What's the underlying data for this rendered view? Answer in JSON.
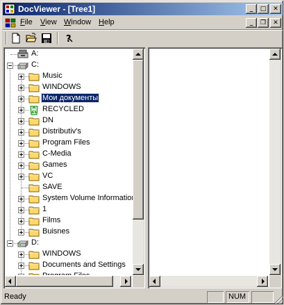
{
  "window": {
    "title": "DocViewer - [Tree1]"
  },
  "menu": {
    "items": [
      {
        "label": "File",
        "accel": "F",
        "rest": "ile"
      },
      {
        "label": "View",
        "accel": "V",
        "rest": "iew"
      },
      {
        "label": "Window",
        "accel": "W",
        "rest": "indow"
      },
      {
        "label": "Help",
        "accel": "H",
        "rest": "elp"
      }
    ]
  },
  "toolbar": {
    "buttons": [
      {
        "name": "new",
        "icon": "new-document-icon"
      },
      {
        "name": "open",
        "icon": "open-folder-icon"
      },
      {
        "name": "save",
        "icon": "floppy-disk-icon"
      },
      {
        "name": "help",
        "icon": "help-question-icon"
      }
    ]
  },
  "tree": {
    "items": [
      {
        "label": "A:",
        "icon": "floppy-drive-icon",
        "level": 0,
        "expander": "none"
      },
      {
        "label": "C:",
        "icon": "hard-drive-icon",
        "level": 0,
        "expander": "minus"
      },
      {
        "label": "Music",
        "icon": "folder-icon",
        "level": 1,
        "expander": "plus"
      },
      {
        "label": "WINDOWS",
        "icon": "folder-icon",
        "level": 1,
        "expander": "plus"
      },
      {
        "label": "Мои документы",
        "icon": "folder-icon",
        "level": 1,
        "expander": "plus",
        "selected": true
      },
      {
        "label": "RECYCLED",
        "icon": "recycle-bin-icon",
        "level": 1,
        "expander": "plus"
      },
      {
        "label": "DN",
        "icon": "folder-icon",
        "level": 1,
        "expander": "plus"
      },
      {
        "label": "Distributiv's",
        "icon": "folder-icon",
        "level": 1,
        "expander": "plus"
      },
      {
        "label": "Program Files",
        "icon": "folder-icon",
        "level": 1,
        "expander": "plus"
      },
      {
        "label": "C-Media",
        "icon": "folder-icon",
        "level": 1,
        "expander": "plus"
      },
      {
        "label": "Games",
        "icon": "folder-icon",
        "level": 1,
        "expander": "plus"
      },
      {
        "label": "VC",
        "icon": "folder-icon",
        "level": 1,
        "expander": "plus"
      },
      {
        "label": "SAVE",
        "icon": "folder-icon",
        "level": 1,
        "expander": "none"
      },
      {
        "label": "System Volume Information",
        "icon": "folder-icon",
        "level": 1,
        "expander": "plus"
      },
      {
        "label": "1",
        "icon": "folder-icon",
        "level": 1,
        "expander": "plus"
      },
      {
        "label": "Films",
        "icon": "folder-icon",
        "level": 1,
        "expander": "plus"
      },
      {
        "label": "Buisnes",
        "icon": "folder-icon",
        "level": 1,
        "expander": "plus"
      },
      {
        "label": "D:",
        "icon": "hard-drive-icon",
        "level": 0,
        "expander": "minus"
      },
      {
        "label": "WINDOWS",
        "icon": "folder-icon",
        "level": 1,
        "expander": "plus"
      },
      {
        "label": "Documents and Settings",
        "icon": "folder-icon",
        "level": 1,
        "expander": "plus"
      },
      {
        "label": "Program Files",
        "icon": "folder-icon",
        "level": 1,
        "expander": "plus"
      }
    ]
  },
  "status": {
    "text": "Ready",
    "num": "NUM"
  },
  "colors": {
    "titlebar": "#0a246a",
    "titlebar_end": "#a6caf0",
    "face": "#d4d0c8",
    "folder": "#ffd86b",
    "selection": "#0a246a"
  }
}
